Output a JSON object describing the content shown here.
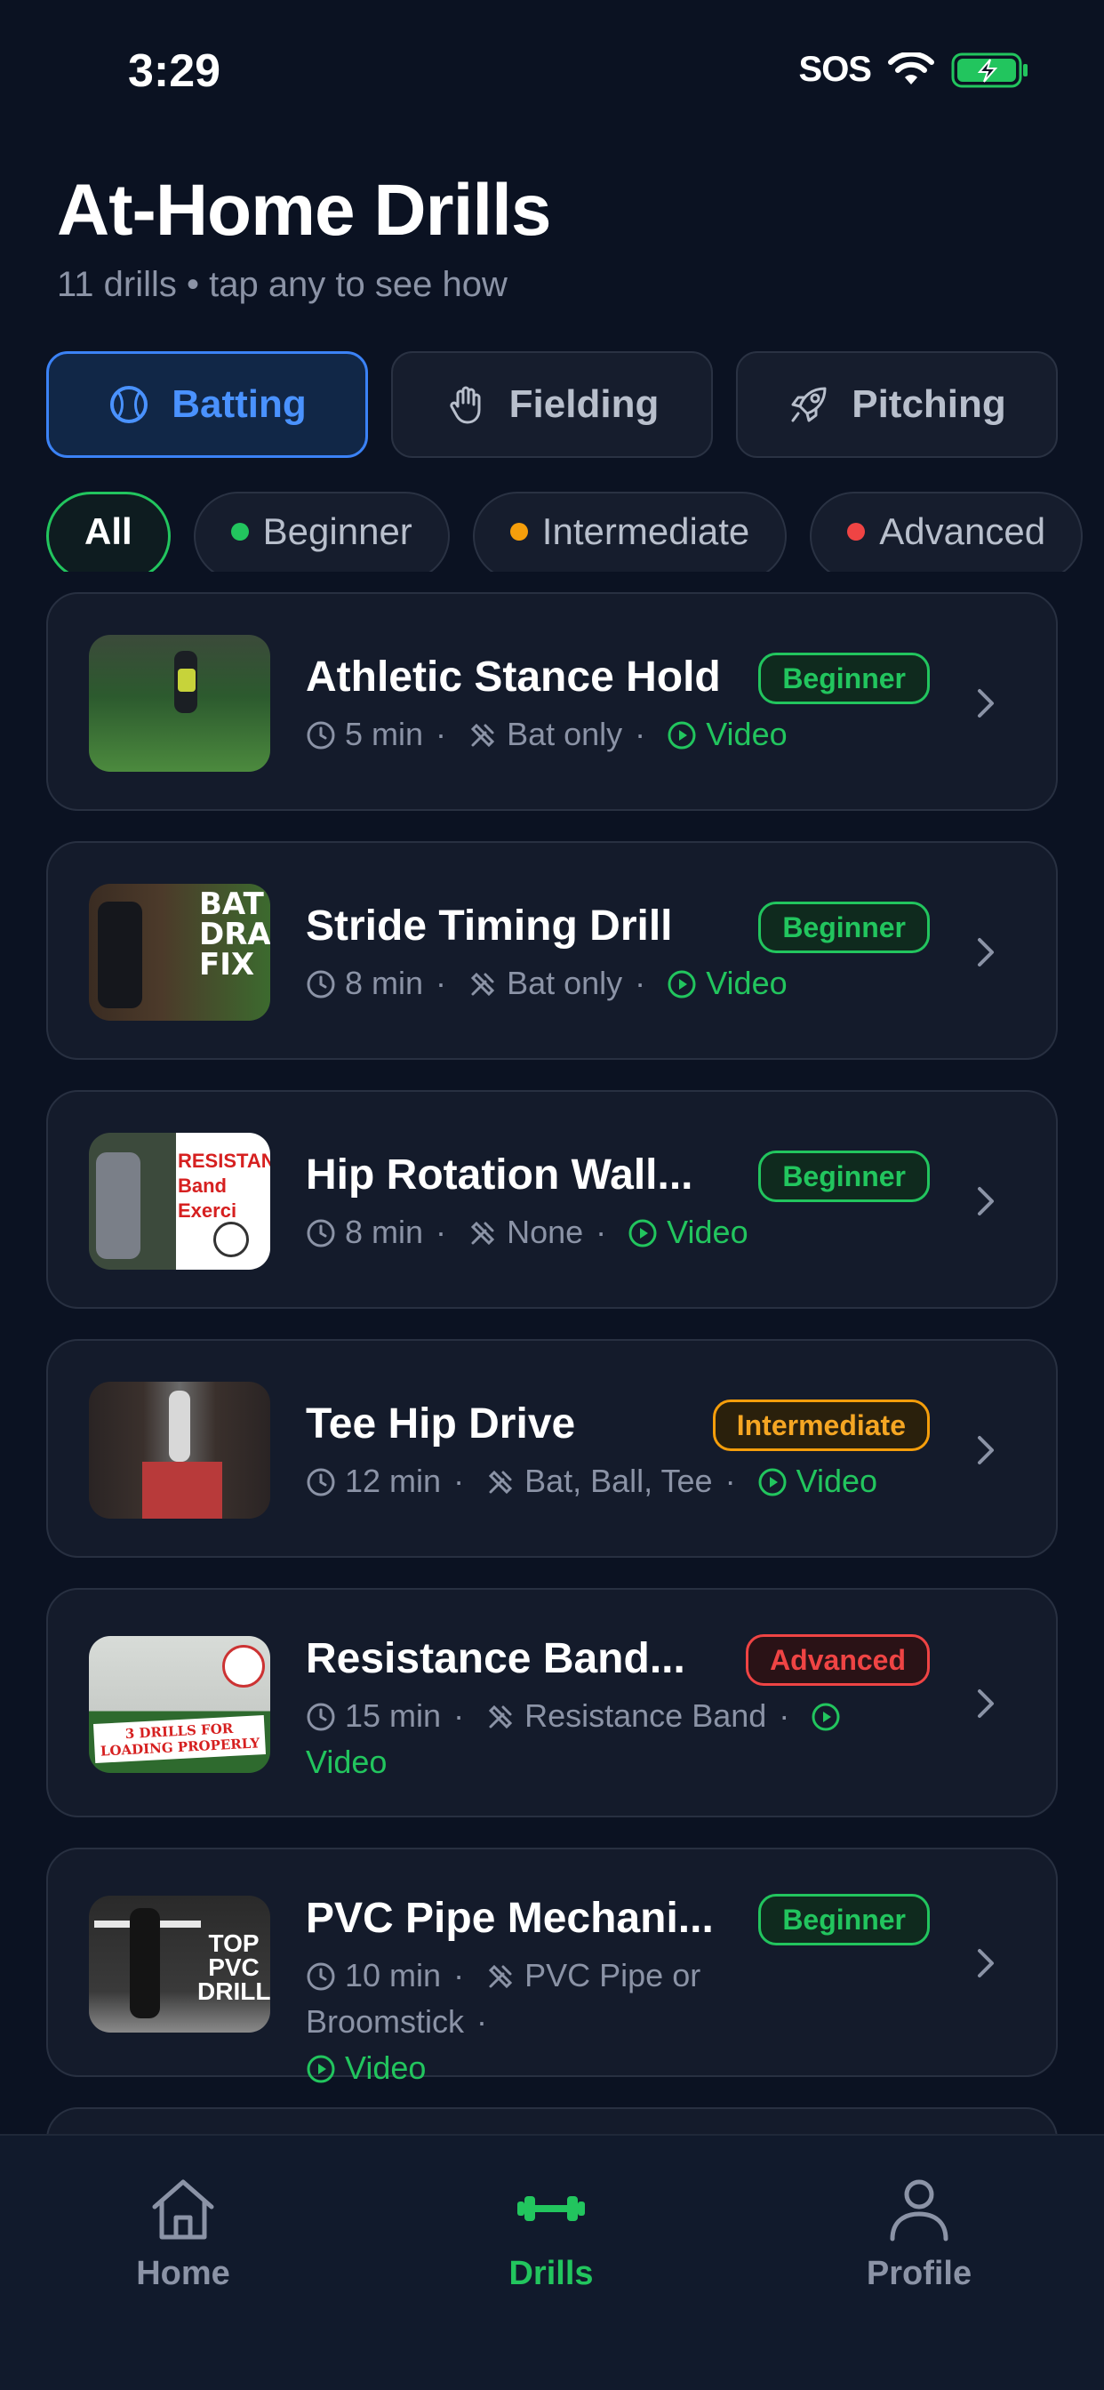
{
  "status": {
    "time": "3:29",
    "carrier": "SOS"
  },
  "header": {
    "title": "At-Home Drills",
    "subtitle": "11 drills • tap any to see how"
  },
  "categories": [
    {
      "label": "Batting",
      "icon": "baseball-icon",
      "active": true
    },
    {
      "label": "Fielding",
      "icon": "hand-icon",
      "active": false
    },
    {
      "label": "Pitching",
      "icon": "rocket-icon",
      "active": false
    }
  ],
  "filters": [
    {
      "label": "All",
      "active": true
    },
    {
      "label": "Beginner",
      "dot": "#22c55e"
    },
    {
      "label": "Intermediate",
      "dot": "#f59e0b"
    },
    {
      "label": "Advanced",
      "dot": "#ef4444"
    }
  ],
  "drills": [
    {
      "title": "Athletic Stance Hold",
      "level": "Beginner",
      "duration": "5 min",
      "equipment": "Bat only",
      "media": "Video"
    },
    {
      "title": "Stride Timing Drill",
      "level": "Beginner",
      "duration": "8 min",
      "equipment": "Bat only",
      "media": "Video",
      "thumb_text": "BAT DRAG FIX"
    },
    {
      "title": "Hip Rotation Wall...",
      "level": "Beginner",
      "duration": "8 min",
      "equipment": "None",
      "media": "Video",
      "thumb_text": "RESISTAN Band Exerci"
    },
    {
      "title": "Tee Hip Drive",
      "level": "Intermediate",
      "duration": "12 min",
      "equipment": "Bat, Ball, Tee",
      "media": "Video"
    },
    {
      "title": "Resistance Band...",
      "level": "Advanced",
      "duration": "15 min",
      "equipment": "Resistance Band",
      "media": "Video",
      "thumb_text": "3 DRILLS FOR LOADING PROPERLY"
    },
    {
      "title": "PVC Pipe Mechani...",
      "level": "Beginner",
      "duration": "10 min",
      "equipment": "PVC Pipe or Broomstick",
      "media": "Video",
      "thumb_text": "TOP PVC DRILLS"
    }
  ],
  "tabbar": [
    {
      "label": "Home",
      "icon": "home-icon",
      "active": false
    },
    {
      "label": "Drills",
      "icon": "dumbbell-icon",
      "active": true
    },
    {
      "label": "Profile",
      "icon": "person-icon",
      "active": false
    }
  ],
  "colors": {
    "accent_blue": "#3b82f6",
    "accent_green": "#22c55e",
    "background": "#0b1222"
  }
}
